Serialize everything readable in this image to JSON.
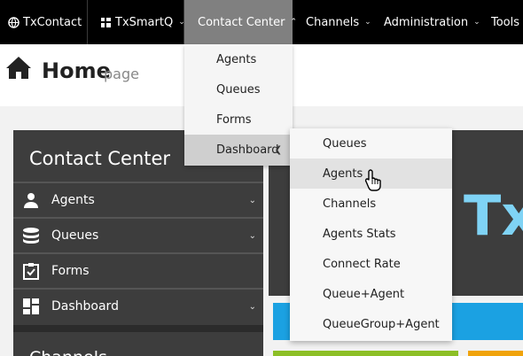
{
  "topnav": {
    "items": [
      {
        "label": "TxContact",
        "icon": "globe-icon"
      },
      {
        "label": "TxSmartQ",
        "icon": "grid-icon"
      },
      {
        "label": "Contact Center"
      },
      {
        "label": "Channels"
      },
      {
        "label": "Administration"
      },
      {
        "label": "Tools"
      }
    ]
  },
  "header": {
    "title": "Home",
    "subtitle": "page"
  },
  "sidebar": {
    "title": "Contact Center",
    "items": [
      {
        "label": "Agents",
        "icon": "user-icon"
      },
      {
        "label": "Queues",
        "icon": "database-icon"
      },
      {
        "label": "Forms",
        "icon": "clipboard-check-icon"
      },
      {
        "label": "Dashboard",
        "icon": "dashboard-icon"
      }
    ],
    "next_title": "Channels"
  },
  "panel": {
    "brand_text": "Tx"
  },
  "contact_center_menu": {
    "items": [
      "Agents",
      "Queues",
      "Forms",
      "Dashboard"
    ]
  },
  "dashboard_menu": {
    "items": [
      "Queues",
      "Agents",
      "Channels",
      "Agents Stats",
      "Connect Rate",
      "Queue+Agent",
      "QueueGroup+Agent"
    ]
  },
  "colors": {
    "nav_bg": "#000000",
    "nav_active": "#808080",
    "sidebar_bg": "#3d3d3d",
    "accent_blue": "#1ba1e2",
    "accent_green": "#8cbf26",
    "accent_orange": "#f0a30a",
    "brand_text": "#7fd3f5"
  }
}
